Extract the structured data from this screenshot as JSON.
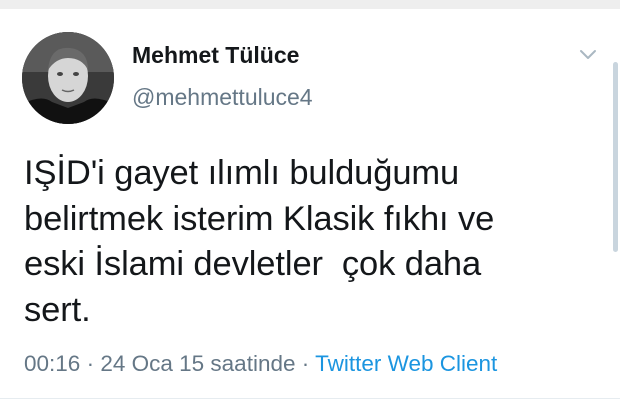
{
  "user": {
    "display_name": "Mehmet Tülüce",
    "username": "@mehmettuluce4",
    "avatar_icon": "profile-photo"
  },
  "tweet": {
    "lines": [
      "IŞİD'i gayet ılımlı bulduğumu",
      "belirtmek isterim Klasik fıkhı ve",
      "eski İslami devletler  çok daha",
      "sert."
    ],
    "time": "00:16",
    "separator": "·",
    "date": "24 Oca 15 saatinde",
    "source": "Twitter Web Client"
  },
  "controls": {
    "caret_icon": "chevron-down-icon"
  },
  "colors": {
    "text": "#14171a",
    "secondary": "#657786",
    "link": "#1b95e0",
    "scrollbar": "#c9d5de"
  }
}
